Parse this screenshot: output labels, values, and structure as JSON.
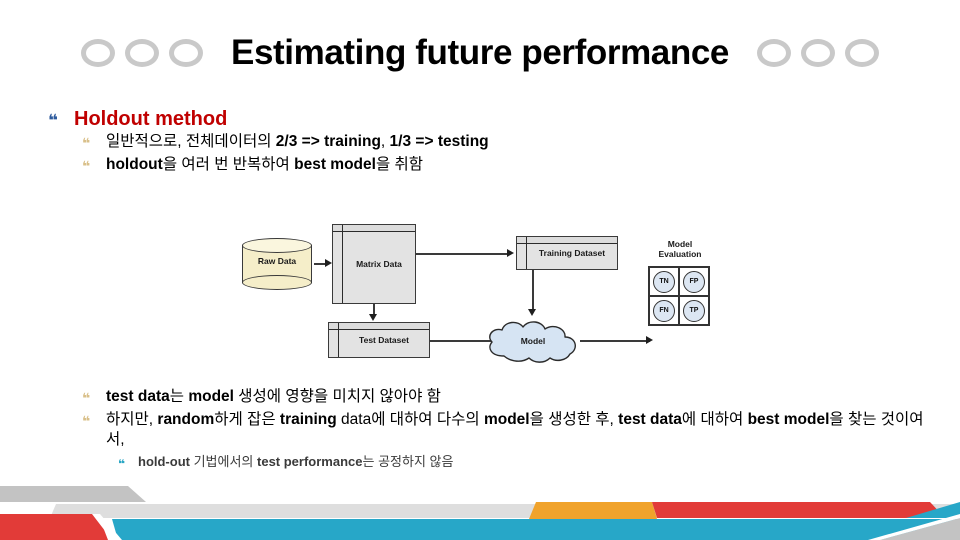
{
  "slide": {
    "title": "Estimating future performance",
    "decor": {
      "ring_count_left": 3,
      "ring_count_right": 3,
      "ring_color": "#c9c9c9"
    },
    "colors": {
      "heading_red": "#c00000",
      "bullet_lvl1": "#2f5c9e",
      "bullet_lvl2": "#d9c08a",
      "bullet_lvl4": "#2aa6c4",
      "footer_red": "#e23b38",
      "footer_cyan": "#27a7c8",
      "footer_orange": "#f0a32c",
      "footer_gray": "#c3c3c3",
      "footer_light_gray": "#dedede"
    }
  },
  "bullets": {
    "marker_glyph": "❝",
    "heading": "Holdout method",
    "sub": [
      "일반적으로, 전체데이터의 2/3 => training, 1/3 => testing",
      "holdout을 여러 번 반복하여 best model을 취함"
    ],
    "lower": [
      "test data는 model 생성에 영향을 미치지 않아야 함",
      "하지만, random하게 잡은 training data에 대하여 다수의 model을 생성한 후, test data에 대하여 best model을 찾는 것이여서,"
    ],
    "lowest": "hold-out 기법에서의 test performance는 공정하지 않음"
  },
  "diagram": {
    "nodes": {
      "raw_data": "Raw Data",
      "matrix_data": "Matrix Data",
      "training_dataset": "Training Dataset",
      "test_dataset": "Test Dataset",
      "model": "Model",
      "model_evaluation": "Model\nEvaluation"
    },
    "confusion_matrix": {
      "cells": [
        "TN",
        "FP",
        "FN",
        "TP"
      ]
    }
  }
}
